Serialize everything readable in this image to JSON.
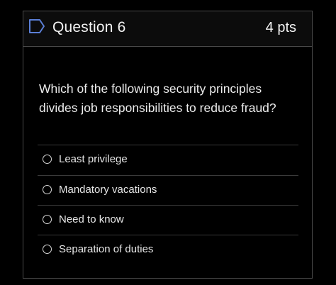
{
  "question": {
    "title": "Question 6",
    "points": "4 pts",
    "text": "Which of the following security principles divides job responsibilities to reduce fraud?",
    "flag_icon": "bookmark-flag-icon",
    "answers": [
      {
        "label": "Least privilege",
        "selected": false
      },
      {
        "label": "Mandatory vacations",
        "selected": false
      },
      {
        "label": "Need to know",
        "selected": false
      },
      {
        "label": "Separation of duties",
        "selected": false
      }
    ]
  },
  "colors": {
    "background": "#000000",
    "text": "#e9e9e9",
    "border": "#4a4a4a",
    "flag_stroke": "#5b7fd6"
  }
}
